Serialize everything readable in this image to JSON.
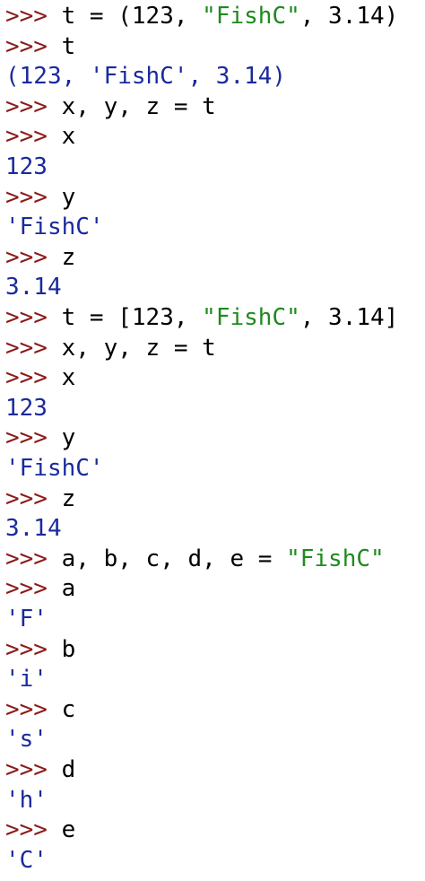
{
  "prompt": ">>> ",
  "lines": [
    {
      "kind": "input",
      "segments": [
        {
          "t": "t = (123, ",
          "c": "code"
        },
        {
          "t": "\"FishC\"",
          "c": "str"
        },
        {
          "t": ", 3.14)",
          "c": "code"
        }
      ]
    },
    {
      "kind": "input",
      "segments": [
        {
          "t": "t",
          "c": "code"
        }
      ]
    },
    {
      "kind": "output",
      "text": "(123, 'FishC', 3.14)"
    },
    {
      "kind": "input",
      "segments": [
        {
          "t": "x, y, z = t",
          "c": "code"
        }
      ]
    },
    {
      "kind": "input",
      "segments": [
        {
          "t": "x",
          "c": "code"
        }
      ]
    },
    {
      "kind": "output",
      "text": "123"
    },
    {
      "kind": "input",
      "segments": [
        {
          "t": "y",
          "c": "code"
        }
      ]
    },
    {
      "kind": "output",
      "text": "'FishC'"
    },
    {
      "kind": "input",
      "segments": [
        {
          "t": "z",
          "c": "code"
        }
      ]
    },
    {
      "kind": "output",
      "text": "3.14"
    },
    {
      "kind": "input",
      "segments": [
        {
          "t": "t = [123, ",
          "c": "code"
        },
        {
          "t": "\"FishC\"",
          "c": "str"
        },
        {
          "t": ", 3.14]",
          "c": "code"
        }
      ]
    },
    {
      "kind": "input",
      "segments": [
        {
          "t": "x, y, z = t",
          "c": "code"
        }
      ]
    },
    {
      "kind": "input",
      "segments": [
        {
          "t": "x",
          "c": "code"
        }
      ]
    },
    {
      "kind": "output",
      "text": "123"
    },
    {
      "kind": "input",
      "segments": [
        {
          "t": "y",
          "c": "code"
        }
      ]
    },
    {
      "kind": "output",
      "text": "'FishC'"
    },
    {
      "kind": "input",
      "segments": [
        {
          "t": "z",
          "c": "code"
        }
      ]
    },
    {
      "kind": "output",
      "text": "3.14"
    },
    {
      "kind": "input",
      "segments": [
        {
          "t": "a, b, c, d, e = ",
          "c": "code"
        },
        {
          "t": "\"FishC\"",
          "c": "str"
        }
      ]
    },
    {
      "kind": "input",
      "segments": [
        {
          "t": "a",
          "c": "code"
        }
      ]
    },
    {
      "kind": "output",
      "text": "'F'"
    },
    {
      "kind": "input",
      "segments": [
        {
          "t": "b",
          "c": "code"
        }
      ]
    },
    {
      "kind": "output",
      "text": "'i'"
    },
    {
      "kind": "input",
      "segments": [
        {
          "t": "c",
          "c": "code"
        }
      ]
    },
    {
      "kind": "output",
      "text": "'s'"
    },
    {
      "kind": "input",
      "segments": [
        {
          "t": "d",
          "c": "code"
        }
      ]
    },
    {
      "kind": "output",
      "text": "'h'"
    },
    {
      "kind": "input",
      "segments": [
        {
          "t": "e",
          "c": "code"
        }
      ]
    },
    {
      "kind": "output",
      "text": "'C'"
    }
  ],
  "colors": {
    "prompt": "#8b1a1a",
    "code": "#000000",
    "string": "#1f8a1f",
    "output": "#1a2a9c",
    "background": "#ffffff"
  }
}
